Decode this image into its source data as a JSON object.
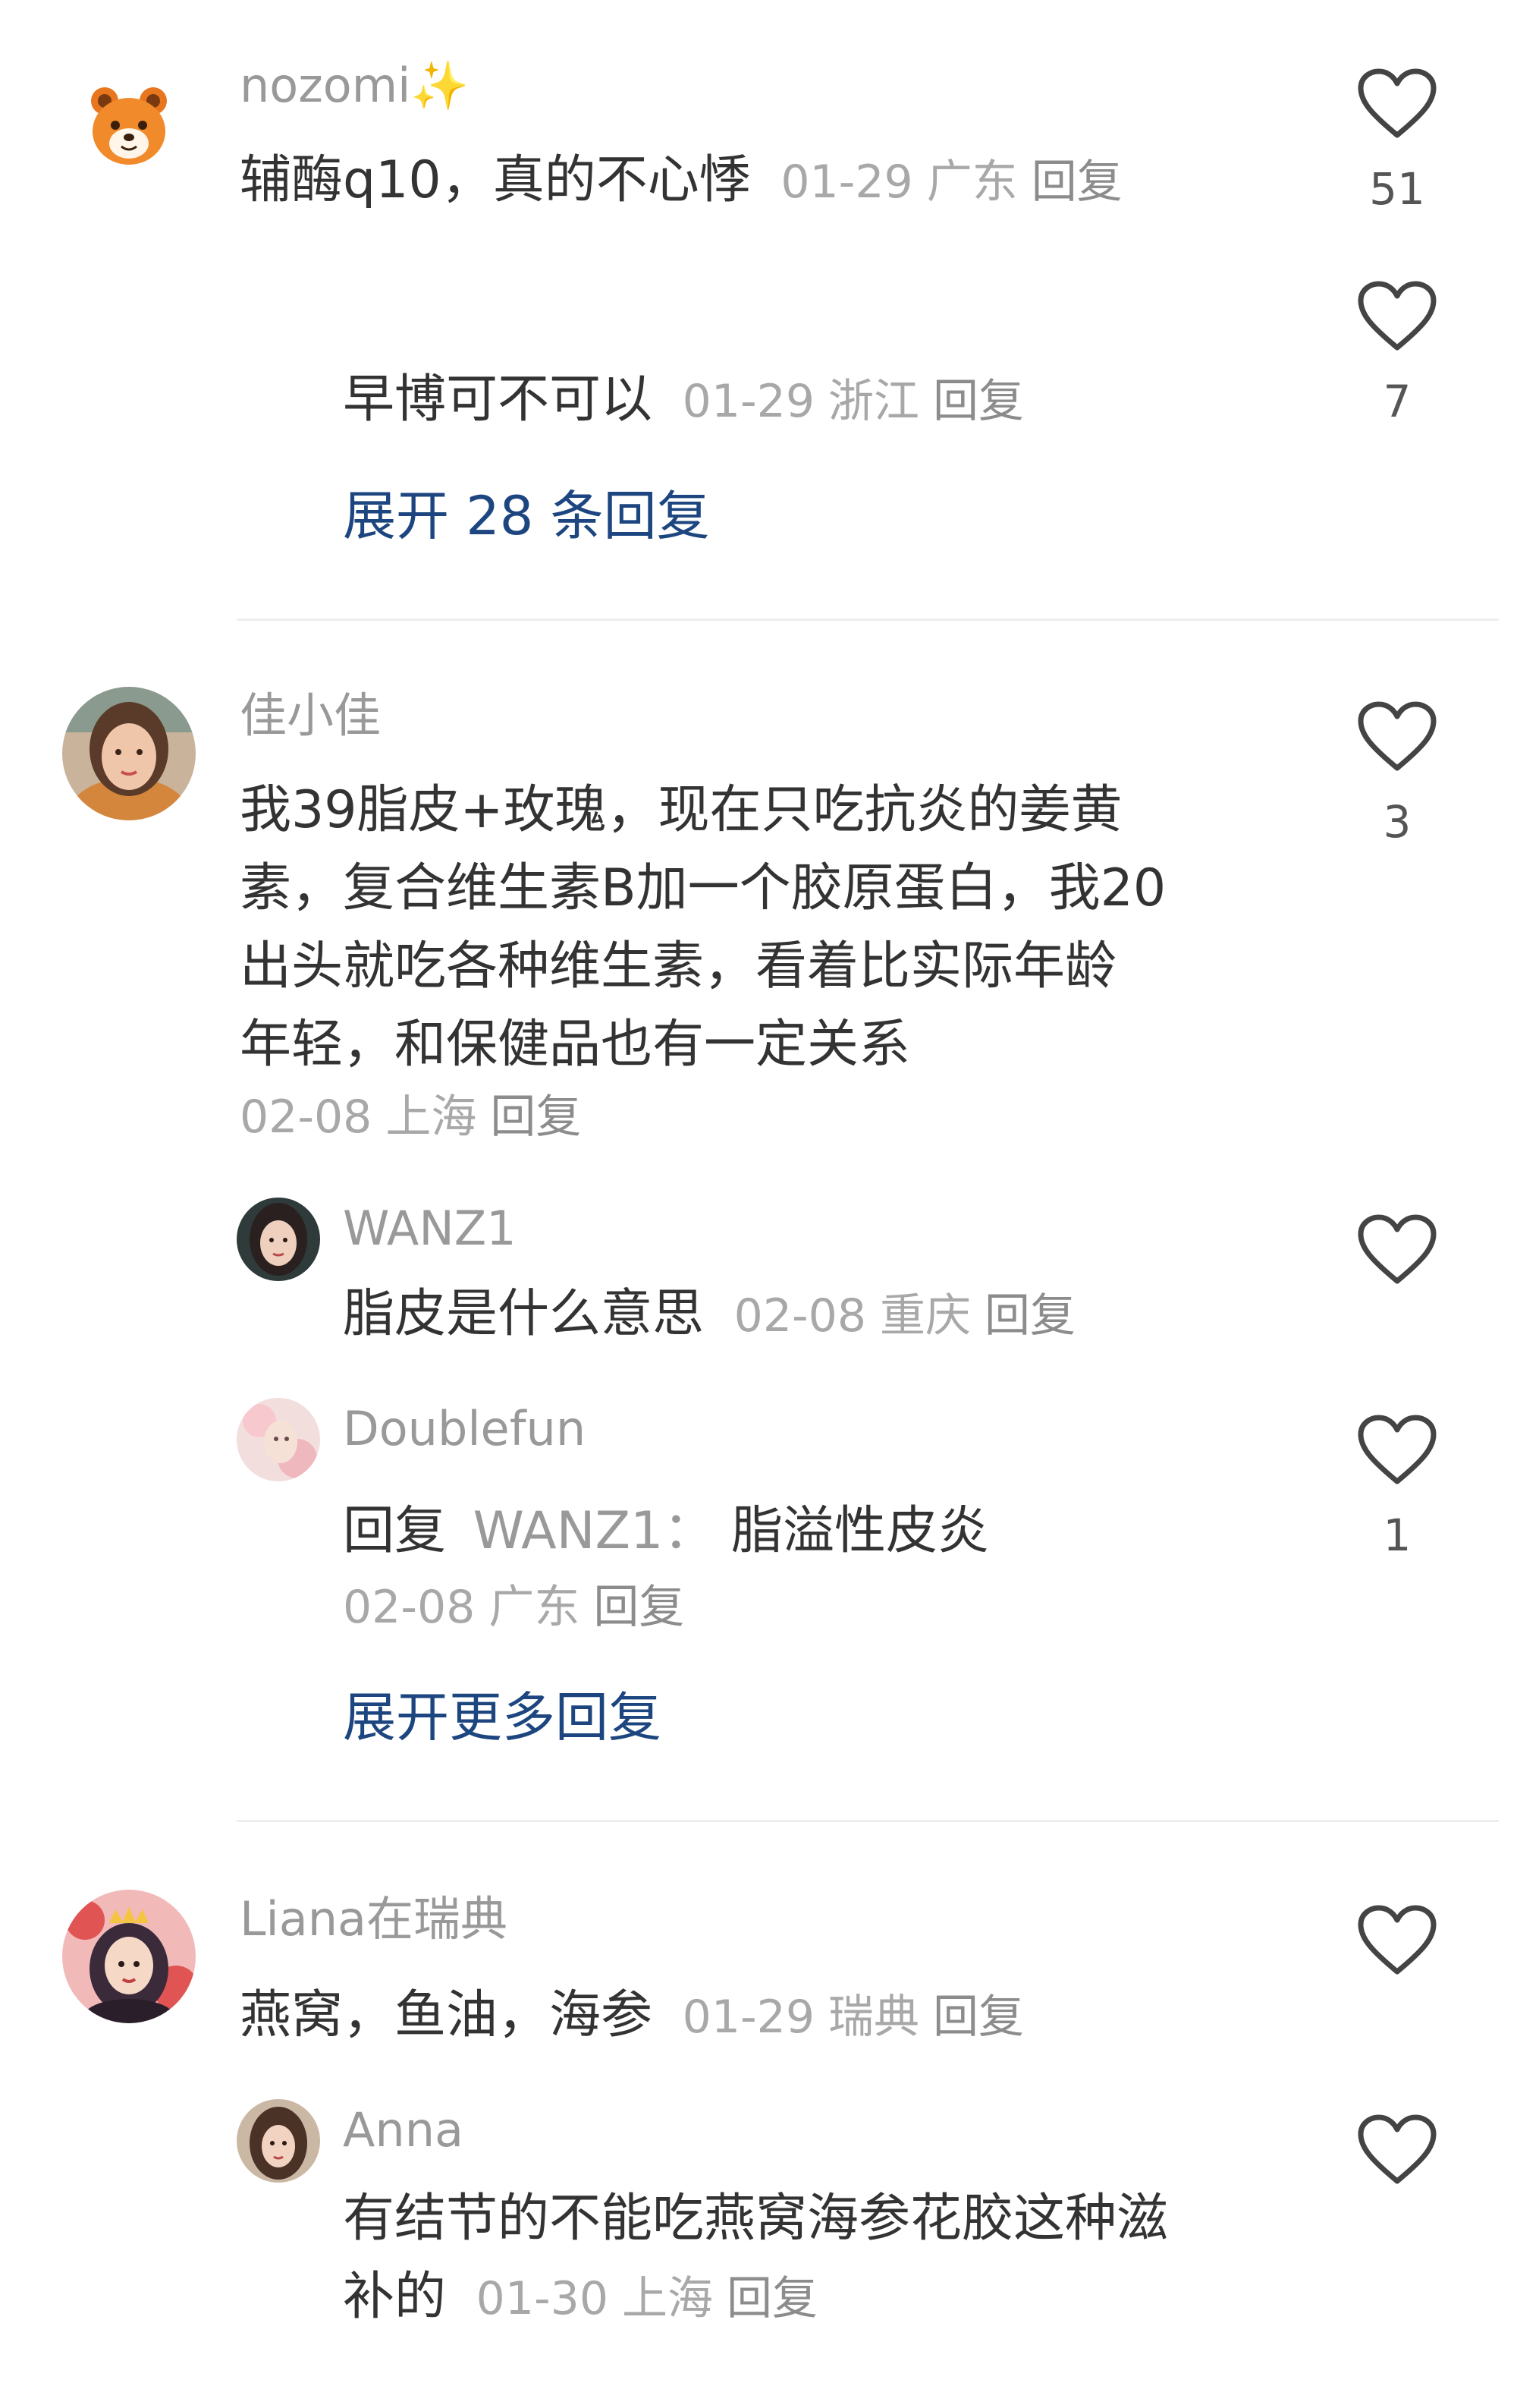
{
  "comments": [
    {
      "username": "nozomi",
      "username_suffix": "✨",
      "text": "辅酶q10，真的不心悸",
      "date": "01-29",
      "location": "广东",
      "reply_label": "回复",
      "likes": "51",
      "replies": [
        {
          "username": "",
          "text": "早博可不可以",
          "date": "01-29",
          "location": "浙江",
          "reply_label": "回复",
          "likes": "7"
        }
      ],
      "expand_label": "展开 28 条回复"
    },
    {
      "username": "佳小佳",
      "text_lines": [
        "我39脂皮+玫瑰，现在只吃抗炎的姜黄",
        "素，复合维生素B加一个胶原蛋白，我20",
        "出头就吃各种维生素，看着比实际年龄",
        "年轻，和保健品也有一定关系"
      ],
      "date": "02-08",
      "location": "上海",
      "reply_label": "回复",
      "likes": "3",
      "replies": [
        {
          "username": "WANZ1",
          "text": "脂皮是什么意思",
          "date": "02-08",
          "location": "重庆",
          "reply_label": "回复",
          "likes": ""
        },
        {
          "username": "Doublefun",
          "reply_prefix": "回复",
          "reply_to": "WANZ1：",
          "text": "脂溢性皮炎",
          "date": "02-08",
          "location": "广东",
          "reply_label": "回复",
          "likes": "1"
        }
      ],
      "expand_label": "展开更多回复"
    },
    {
      "username": "Liana在瑞典",
      "text": "燕窝，鱼油，海参",
      "date": "01-29",
      "location": "瑞典",
      "reply_label": "回复",
      "likes": "",
      "replies": [
        {
          "username": "Anna",
          "text_lines": [
            "有结节的不能吃燕窝海参花胶这种滋",
            "补的"
          ],
          "date": "01-30",
          "location": "上海",
          "reply_label": "回复",
          "likes": ""
        }
      ]
    }
  ],
  "icons": {
    "like": "heart-outline-icon"
  },
  "colors": {
    "link": "#1d4680",
    "meta": "#a8a8a8",
    "name": "#999999",
    "text": "#333333"
  }
}
